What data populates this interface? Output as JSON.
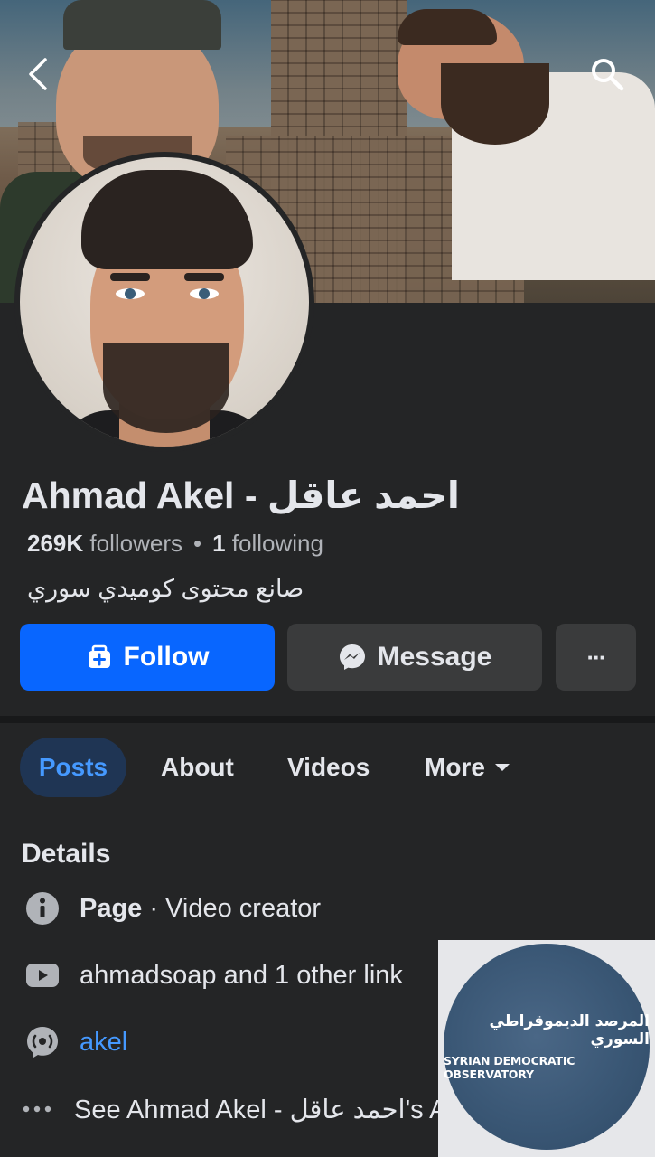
{
  "profile": {
    "name": "Ahmad Akel - احمد عاقل",
    "followers_count": "269K",
    "followers_label": "followers",
    "following_count": "1",
    "following_label": "following",
    "separator": "•",
    "bio": "صانع محتوى كوميدي سوري"
  },
  "actions": {
    "follow_label": "Follow",
    "message_label": "Message",
    "more_label": "···"
  },
  "tabs": [
    {
      "label": "Posts",
      "active": true
    },
    {
      "label": "About"
    },
    {
      "label": "Videos"
    },
    {
      "label": "More"
    }
  ],
  "details": {
    "title": "Details",
    "page_type_bold": "Page",
    "page_type_rest": " · Video creator",
    "links_text": "ahmadsoap and 1 other link",
    "threads_handle": "akel",
    "see_about": "See Ahmad Akel - احمد عاقل's About Info"
  },
  "watermark": {
    "arabic": "المرصد الديموقراطي السوري",
    "english": "SYRIAN DEMOCRATIC OBSERVATORY"
  },
  "colors": {
    "background": "#242526",
    "accent": "#0866ff",
    "link": "#4599ff",
    "secondary_button": "#3a3b3c"
  },
  "icons": [
    "back-arrow-icon",
    "search-icon",
    "add-friend-icon",
    "messenger-icon",
    "more-dots-icon",
    "caret-down-icon",
    "info-icon",
    "youtube-icon",
    "threads-icon",
    "ellipsis-icon"
  ]
}
